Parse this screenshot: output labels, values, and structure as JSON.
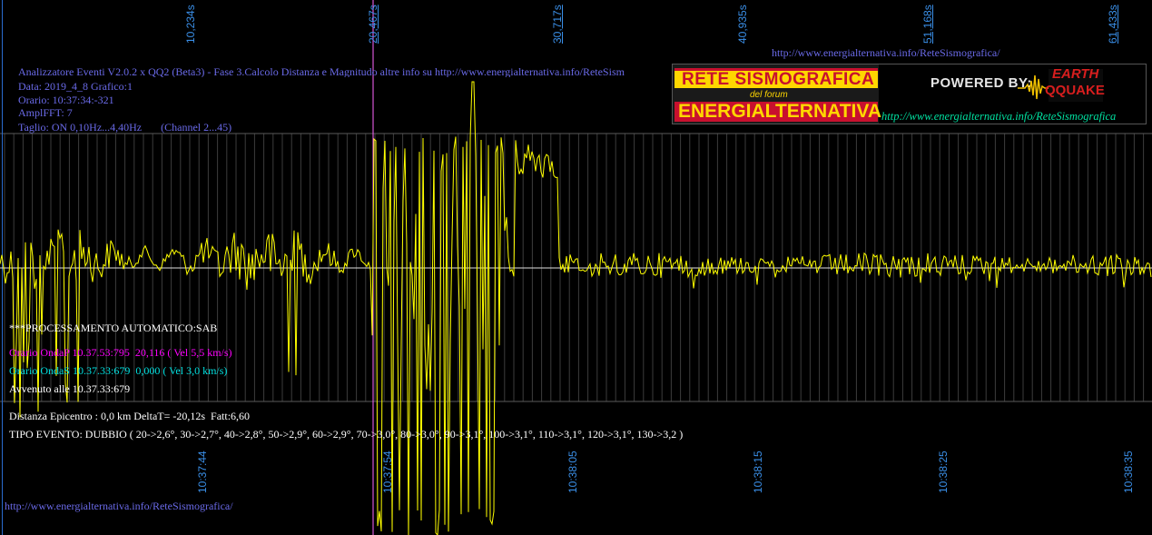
{
  "header": {
    "top_url": "http://www.energialternativa.info/ReteSismografica/",
    "app_title": "Analizzatore Eventi V2.0.2 x QQ2 (Beta3) - Fase 3.Calcolo Distanza e Magnitudo altre info su http://www.energialternativa.info/ReteSism",
    "data_line": "Data: 2019_4_8 Grafico:1",
    "orario_line": "Orario: 10:37:34:-321",
    "ampl_line": "AmplFFT: 7",
    "taglio_line": "Taglio: ON 0,10Hz...4,40Hz       (Channel 2...45)"
  },
  "banner": {
    "title_top": "RETE SISMOGRAFICA",
    "subtitle": "del forum",
    "title_bottom": "ENERGIALTERNATIVA",
    "powered_by": "POWERED BY:",
    "logo_top": "EARTH",
    "logo_bottom": "QQUAKE",
    "url": "http://www.energialternativa.info/ReteSismografica"
  },
  "top_ticks": [
    "10,234s",
    "20,467s",
    "30,717s",
    "40,935s",
    "51,168s",
    "61,433s"
  ],
  "bottom_ticks": [
    "10:37:44",
    "10:37:54",
    "10:38:05",
    "10:38:15",
    "10:38:25",
    "10:38:35"
  ],
  "processing": {
    "title": "***PROCESSAMENTO AUTOMATICO:SAB",
    "onda_p": "Orario OndaP 10.37.53:795  20,116 ( Vel 5,5 km/s)",
    "onda_s": "Orario OndaS 10.37.33:679  0,000 ( Vel 3,0 km/s)",
    "avvenuto": "Avvenuto alle 10.37.33:679",
    "distanza": "Distanza Epicentro : 0,0 km DeltaT= -20,12s  Fatt:6,60",
    "tipo_evento": "TIPO EVENTO: DUBBIO ( 20->2,6°, 30->2,7°, 40->2,8°, 50->2,9°, 60->2,9°, 70->3,0°, 80->3,0°, 90->3,1°, 100->3,1°, 110->3,1°, 120->3,1°, 130->3,2 )"
  },
  "footer_url": "http://www.energialternativa.info/ReteSismografica/",
  "colors": {
    "background": "#000000",
    "trace": "#ffff00",
    "grid": "#5a5a5a",
    "baseline": "#e0e0e0",
    "marker_p": "#ff66ff",
    "marker_s": "#4444ff",
    "tick_label": "#3a8fe8"
  },
  "icons": {
    "seismograph_logo": "seismograph-wave-icon"
  }
}
